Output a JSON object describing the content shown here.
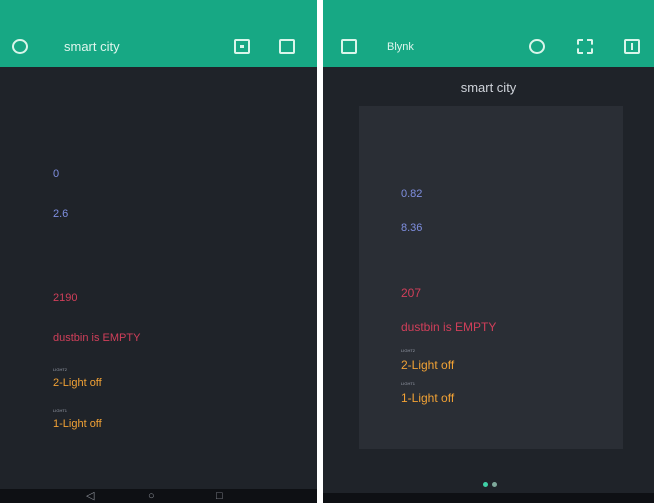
{
  "left_screen": {
    "appbar": {
      "title": "smart city"
    },
    "widgets": [
      {
        "value": "0"
      },
      {
        "value": "2.6"
      },
      {
        "value": "2190"
      },
      {
        "value": "dustbin is EMPTY"
      }
    ],
    "lights": [
      {
        "label": "LIGHT2",
        "value": "2-Light off"
      },
      {
        "label": "LIGHT1",
        "value": "1-Light off"
      }
    ]
  },
  "right_screen": {
    "appbar": {
      "title": "Blynk"
    },
    "project_title": "smart city",
    "widgets": [
      {
        "value": "0.82"
      },
      {
        "value": "8.36"
      },
      {
        "value": "207"
      },
      {
        "value": "dustbin is EMPTY"
      }
    ],
    "lights": [
      {
        "label": "LIGHT2",
        "value": "2-Light off"
      },
      {
        "label": "LIGHT1",
        "value": "1-Light off"
      }
    ],
    "page_indicator": {
      "pages": 2,
      "current": 1
    }
  },
  "colors": {
    "appbar": "#17a884",
    "background": "#1f2329",
    "panel": "#2a2e35",
    "sensor_value": "#7f8fe0",
    "alert_value": "#d13f5a",
    "light_value": "#f2a235"
  },
  "icons": {
    "left_appbar": [
      "back-icon",
      "device-icon",
      "stop-icon"
    ],
    "right_appbar": [
      "exit-icon",
      "add-icon",
      "qr-icon",
      "info-icon"
    ],
    "navbar": [
      "back-icon",
      "home-icon",
      "recents-icon"
    ]
  }
}
